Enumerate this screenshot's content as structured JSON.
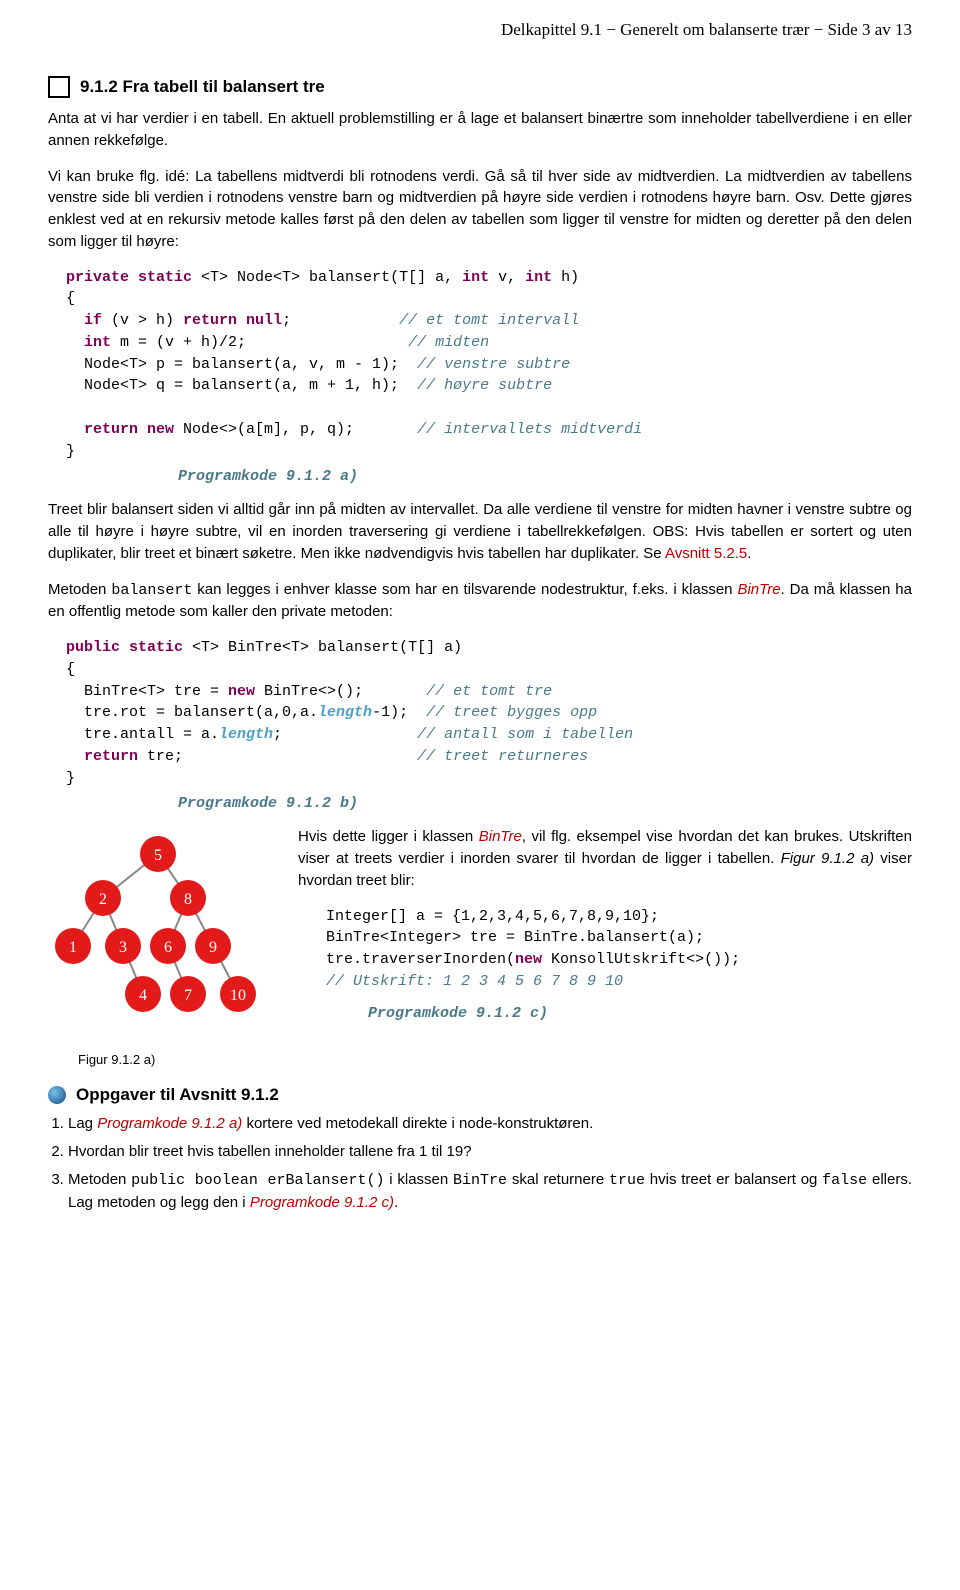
{
  "header": "Delkapittel 9.1 − Generelt om balanserte trær − Side 3 av 13",
  "h1": "9.1.2 Fra tabell til balansert tre",
  "p1": "Anta at vi har verdier i en tabell. En aktuell problemstilling er å lage et balansert binærtre som inneholder tabellverdiene i en eller annen rekkefølge.",
  "p2": "Vi kan bruke flg. idé: La tabellens midtverdi bli rotnodens verdi. Gå så til hver side av midtverdien. La midtverdien av tabellens venstre side bli verdien i rotnodens venstre barn og midtverdien på høyre side verdien i rotnodens høyre barn. Osv. Dette gjøres enklest ved at en rekursiv metode kalles først på den delen av tabellen som ligger til venstre for midten og deretter på den delen som ligger til høyre:",
  "code1": {
    "l01a": "private static",
    "l01b": " <T> Node<T> balansert(T[] a, ",
    "l01c": "int",
    "l01d": " v, ",
    "l01e": "int",
    "l01f": " h)",
    "l02": "{",
    "l03a": "  if",
    "l03b": " (v > h) ",
    "l03c": "return null",
    "l03d": ";            ",
    "l03e": "// et tomt intervall",
    "l04a": "  int",
    "l04b": " m = (v + h)/2;                  ",
    "l04c": "// midten",
    "l05a": "  Node<T> p = balansert(a, v, m - 1);  ",
    "l05b": "// venstre subtre",
    "l06a": "  Node<T> q = balansert(a, m + 1, h);  ",
    "l06b": "// høyre subtre",
    "l07": "",
    "l08a": "  return new",
    "l08b": " Node<>(a[m], p, q);       ",
    "l08c": "// intervallets midtverdi",
    "l09": "}"
  },
  "caption1": "Programkode 9.1.2 a)",
  "p3a": "Treet blir balansert siden vi alltid går inn på midten av intervallet. Da alle verdiene til venstre for midten havner i venstre subtre og alle til høyre i høyre subtre, vil en inorden traversering gi verdiene i tabellrekkefølgen. OBS: Hvis tabellen er sortert og uten duplikater, blir treet et binært søketre. Men ikke nødvendigvis hvis tabellen har duplikater. Se ",
  "p3b": "Avsnitt 5.2.5",
  "p3c": ".",
  "p4a": "Metoden ",
  "p4m": "balansert",
  "p4b": " kan legges i enhver klasse som har en tilsvarende nodestruktur, f.eks. i klassen ",
  "p4c": "BinTre",
  "p4d": ". Da må klassen ha en offentlig metode som kaller den private metoden:",
  "code2": {
    "l01a": "public static",
    "l01b": " <T> BinTre<T> balansert(T[] a)",
    "l02": "{",
    "l03a": "  BinTre<T> tre = ",
    "l03b": "new",
    "l03c": " BinTre<>();       ",
    "l03d": "// et tomt tre",
    "l04a": "  tre.rot = balansert(a,0,a.",
    "l04b": "length",
    "l04c": "-1);  ",
    "l04d": "// treet bygges opp",
    "l05a": "  tre.antall = a.",
    "l05b": "length",
    "l05c": ";               ",
    "l05d": "// antall som i tabellen",
    "l06a": "  return",
    "l06b": " tre;                          ",
    "l06c": "// treet returneres",
    "l07": "}"
  },
  "caption2": "Programkode 9.1.2 b)",
  "p5a": "Hvis dette ligger i klassen ",
  "p5b": "BinTre",
  "p5c": ", vil flg. eksempel vise hvordan det kan brukes. Utskriften viser at treets verdier i inorden svarer til hvordan de ligger i tabellen. ",
  "p5d": "Figur 9.1.2 a)",
  "p5e": " viser hvordan treet blir:",
  "code3": {
    "l1": "Integer[] a = {1,2,3,4,5,6,7,8,9,10};",
    "l2": "BinTre<Integer> tre = BinTre.balansert(a);",
    "l3a": "tre.traverserInorden(",
    "l3b": "new",
    "l3c": " KonsollUtskrift<>());",
    "l4": "// Utskrift: 1 2 3 4 5 6 7 8 9 10"
  },
  "caption3": "Programkode 9.1.2 c)",
  "figcap": "Figur 9.1.2 a)",
  "h2": "Oppgaver til Avsnitt 9.1.2",
  "task1a": "Lag ",
  "task1b": "Programkode 9.1.2 a)",
  "task1c": " kortere ved metodekall direkte i node-konstruktøren.",
  "task2": "Hvordan blir treet hvis tabellen inneholder tallene fra 1 til 19?",
  "task3a": "Metoden ",
  "task3m1": "public boolean erBalansert()",
  "task3b": " i klassen ",
  "task3m2": "BinTre",
  "task3c": " skal returnere ",
  "task3m3": "true",
  "task3d": " hvis treet er balansert og ",
  "task3m4": "false",
  "task3e": " ellers. Lag metoden og legg den i ",
  "task3f": "Programkode 9.1.2 c)",
  "task3g": ".",
  "tree_nodes": [
    "5",
    "2",
    "8",
    "1",
    "3",
    "6",
    "9",
    "4",
    "7",
    "10"
  ]
}
